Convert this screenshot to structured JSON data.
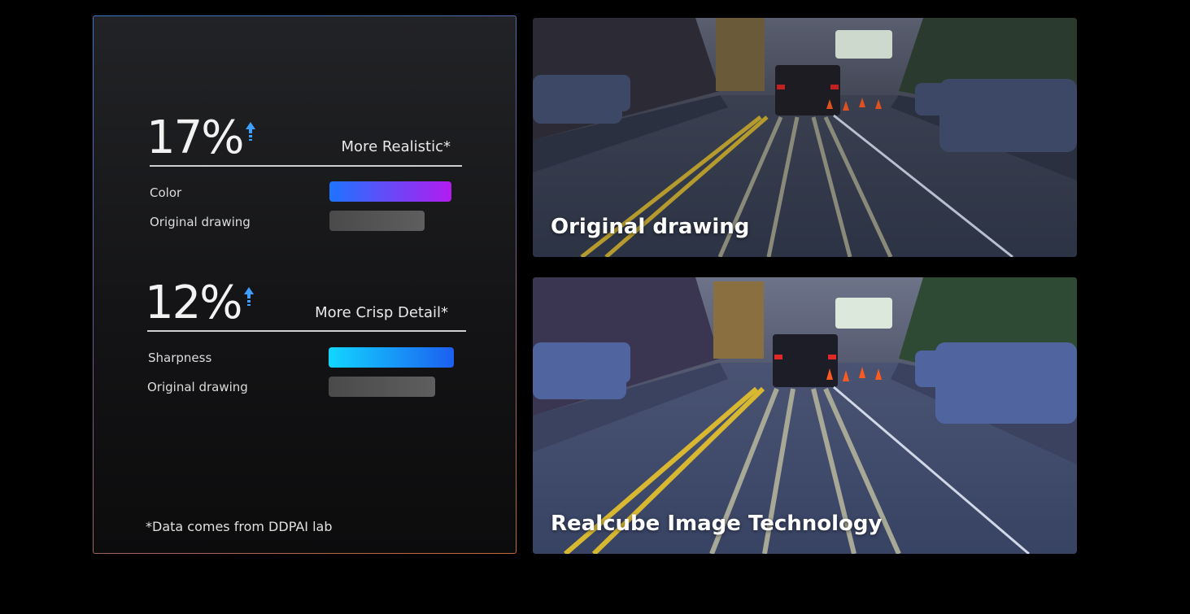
{
  "comparison": {
    "stat1": {
      "value": "17%",
      "label": "More Realistic*",
      "rows": [
        {
          "label": "Color",
          "level": 1.0
        },
        {
          "label": "Original drawing",
          "level": 0.78
        }
      ]
    },
    "stat2": {
      "value": "12%",
      "label": "More Crisp Detail*",
      "rows": [
        {
          "label": "Sharpness",
          "level": 1.0
        },
        {
          "label": "Original drawing",
          "level": 0.85
        }
      ]
    },
    "footnote": "*Data comes from DDPAI lab",
    "colors": {
      "color_bar": [
        "#1e74ff",
        "#b21cf0"
      ],
      "sharpness_bar": [
        "#12d6ff",
        "#1c5ff0"
      ],
      "arrow": "#3da0ff"
    }
  },
  "images": {
    "top_caption": "Original drawing",
    "bottom_caption": "Realcube Image Technology"
  }
}
